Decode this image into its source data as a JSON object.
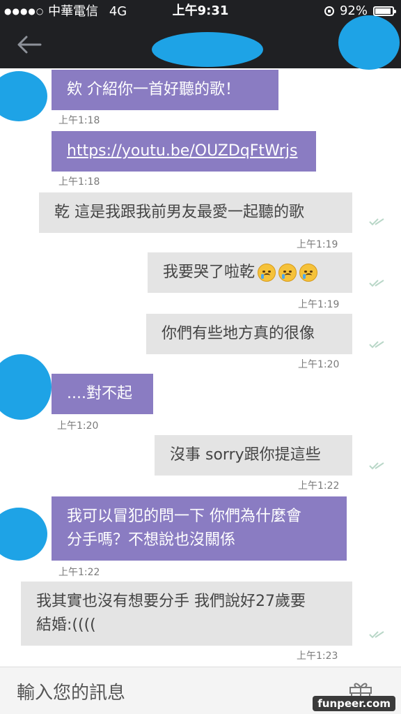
{
  "status_bar": {
    "carrier": "中華電信",
    "network": "4G",
    "time": "上午9:31",
    "battery_percent": "92%",
    "battery_level": 0.92
  },
  "header": {
    "back_icon": "arrow-left-icon"
  },
  "messages": [
    {
      "text": "欸 介紹你一首好聽的歌！",
      "time": "上午1:18"
    },
    {
      "text": "https://youtu.be/OUZDqFtWrjs",
      "time": "上午1:18"
    },
    {
      "text": "乾 這是我跟我前男友最愛一起聽的歌",
      "time": "上午1:19"
    },
    {
      "text": "我要哭了啦乾",
      "time": "上午1:19",
      "emoji_count": 3
    },
    {
      "text": "你們有些地方真的很像",
      "time": "上午1:20"
    },
    {
      "text": "....對不起",
      "time": "上午1:20"
    },
    {
      "text": "沒事 sorry跟你提這些",
      "time": "上午1:22"
    },
    {
      "line1": "我可以冒犯的問一下 你們為什麼會",
      "line2": "分手嗎？不想說也沒關係",
      "time": "上午1:22"
    },
    {
      "line1": "我其實也沒有想要分手 我們說好27歲要",
      "line2": "結婚:((((",
      "time": "上午1:23"
    }
  ],
  "input": {
    "placeholder": "輸入您的訊息",
    "gift_icon": "gift-icon"
  },
  "watermark": "funpeer.com",
  "colors": {
    "incoming_bubble": "#8a7cc2",
    "outgoing_bubble": "#e4e4e4",
    "redaction": "#1ea3e6",
    "header_bg": "#1f2023"
  }
}
